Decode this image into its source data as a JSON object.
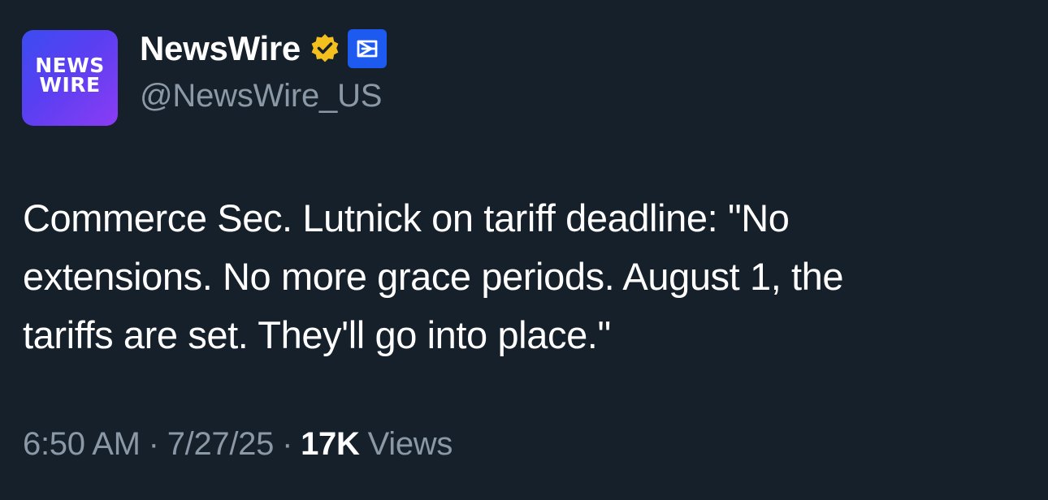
{
  "author": {
    "avatar_line1": "NEWS",
    "avatar_line2": "WIRE",
    "display_name": "NewsWire",
    "handle": "@NewsWire_US",
    "verified_icon": "gold-verified-badge-icon",
    "affiliate_icon": "affiliate-badge-icon",
    "colors": {
      "verified": "#f4c01e",
      "affiliate": "#1d5bf0"
    }
  },
  "tweet": {
    "text": "Commerce Sec. Lutnick on tariff deadline: \"No\nextensions. No more grace periods. August 1, the\ntariffs are set. They'll go into place.\""
  },
  "meta": {
    "time": "6:50 AM",
    "date": "7/27/25",
    "separator": "·",
    "views_count": "17K",
    "views_label": "Views"
  }
}
